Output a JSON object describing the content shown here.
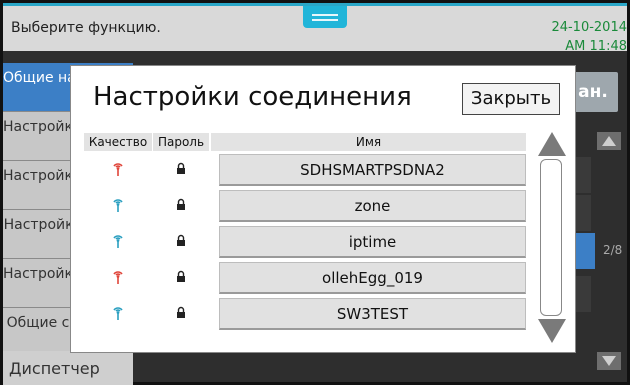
{
  "header": {
    "message": "Выберите функцию.",
    "date": "24-10-2014",
    "time": "AM 11:48"
  },
  "sidebar": {
    "items": [
      {
        "label": "Общие настройки",
        "active": true
      },
      {
        "label": "Настройки копирования",
        "active": false
      },
      {
        "label": "Настройки сканирования",
        "active": false
      },
      {
        "label": "Настройки факса",
        "active": false
      },
      {
        "label": "Настройки печати",
        "active": false
      },
      {
        "label": "Общие счетчики",
        "active": false
      }
    ],
    "bottom_label": "Диспетчер"
  },
  "right_panel": {
    "button_label": "ан.",
    "page_indicator": "2/8"
  },
  "dialog": {
    "title": "Настройки соединения",
    "close_label": "Закрыть",
    "columns": {
      "quality": "Качество",
      "password": "Пароль",
      "name": "Имя"
    },
    "networks": [
      {
        "name": "SDHSMARTPSDNA2",
        "signal": "weak",
        "locked": true
      },
      {
        "name": "zone",
        "signal": "strong",
        "locked": true
      },
      {
        "name": "iptime",
        "signal": "strong",
        "locked": true
      },
      {
        "name": "ollehEgg_019",
        "signal": "weak",
        "locked": true
      },
      {
        "name": "SW3TEST",
        "signal": "strong",
        "locked": true
      }
    ]
  },
  "colors": {
    "accent": "#21b5d9",
    "signal_weak": "#e0453a",
    "signal_strong": "#2a9fc0",
    "sidebar_active": "#3c7fc6",
    "date_text": "#1a8a3a"
  },
  "icons": {
    "signal": "wifi-signal-icon",
    "lock": "lock-icon",
    "scroll_up": "triangle-up-icon",
    "scroll_down": "triangle-down-icon"
  }
}
